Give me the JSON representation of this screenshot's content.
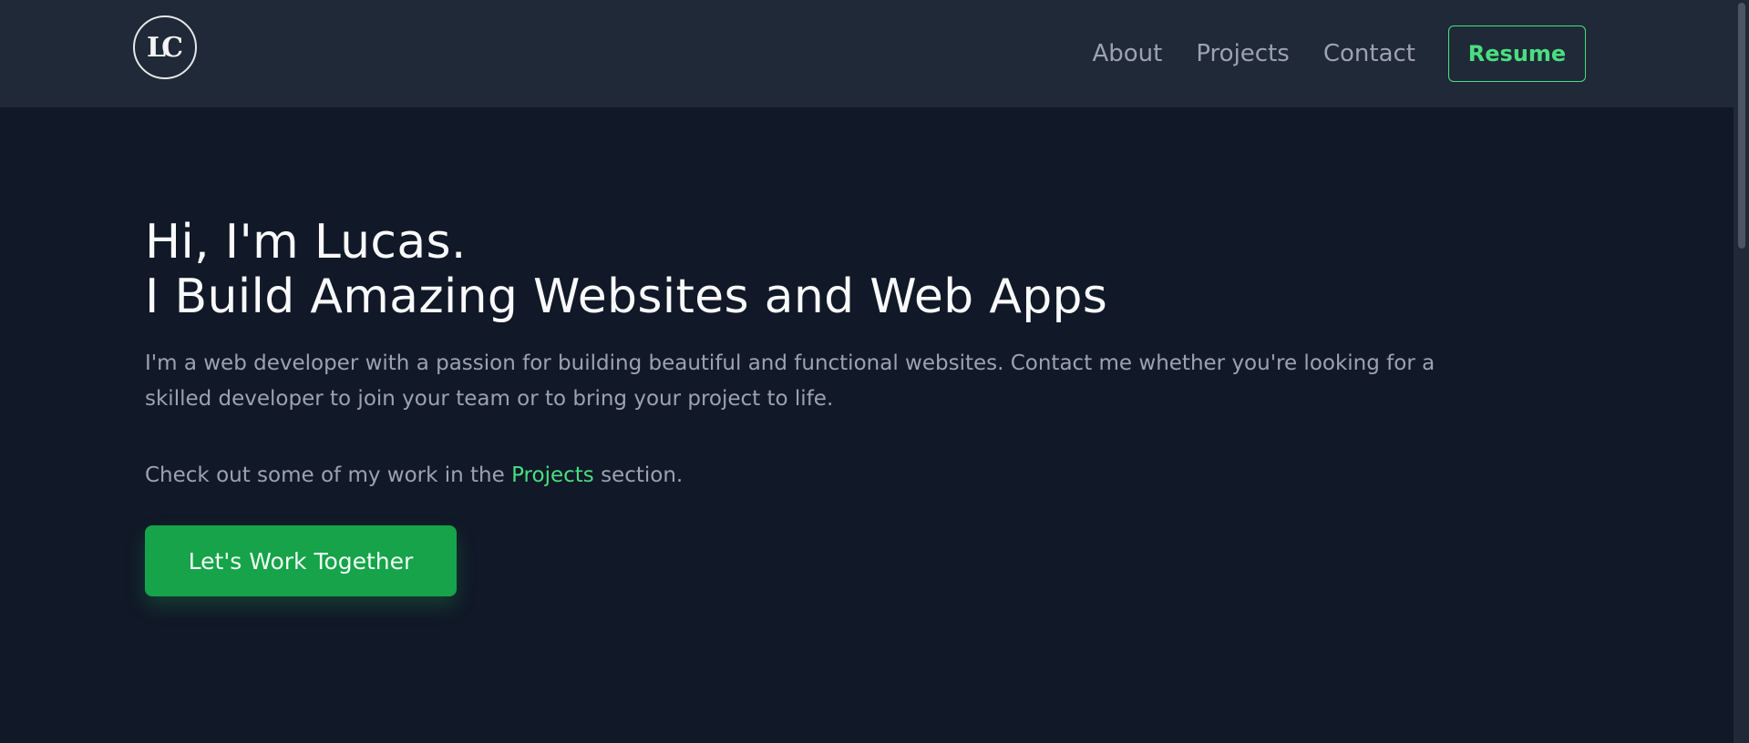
{
  "nav": {
    "logo_text": "LC",
    "links": [
      "About",
      "Projects",
      "Contact"
    ],
    "resume_label": "Resume"
  },
  "hero": {
    "greeting": "Hi, I'm Lucas.",
    "headline": "I Build Amazing Websites and Web Apps",
    "description": "I'm a web developer with a passion for building beautiful and functional websites. Contact me whether you're looking for a skilled developer to join your team or to bring your project to life.",
    "check_prefix": "Check out some of my work in the ",
    "check_link": "Projects",
    "check_suffix": " section.",
    "cta_label": "Let's Work Together"
  },
  "colors": {
    "background": "#111827",
    "navbar": "#1f2937",
    "accent": "#4ade80",
    "cta": "#16a34a"
  }
}
